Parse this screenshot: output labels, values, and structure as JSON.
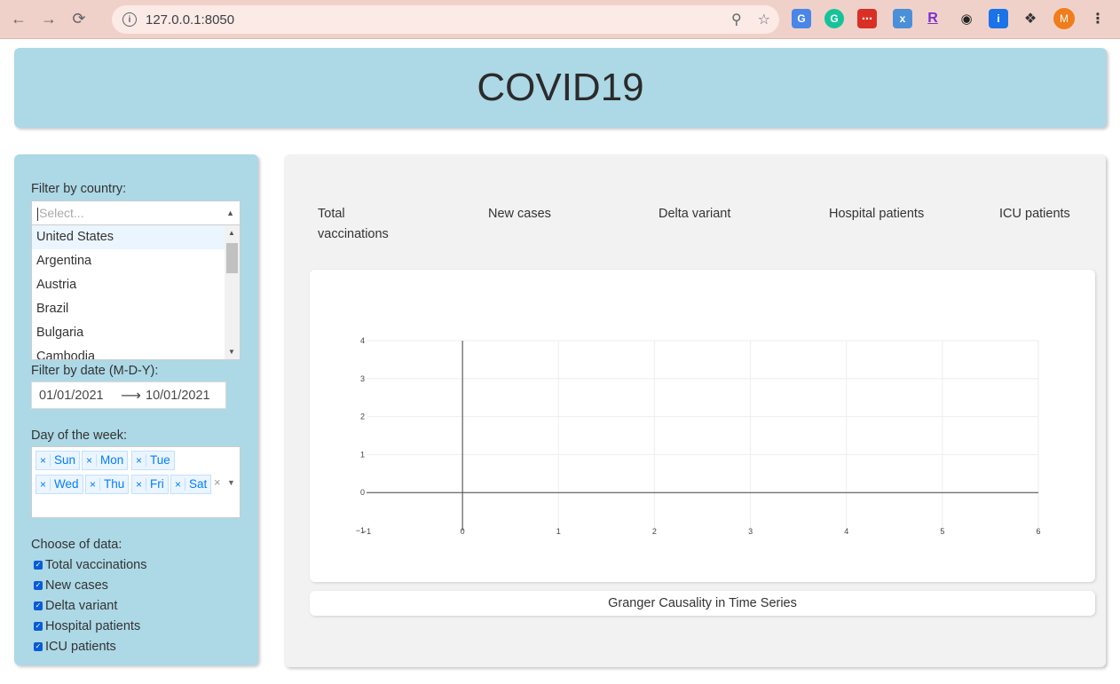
{
  "browser": {
    "url": "127.0.0.1:8050",
    "profile_initial": "M"
  },
  "header": {
    "title": "COVID19"
  },
  "sidebar": {
    "country_label": "Filter by country:",
    "country_placeholder": "Select...",
    "country_options": [
      "United States",
      "Argentina",
      "Austria",
      "Brazil",
      "Bulgaria",
      "Cambodia"
    ],
    "date_label": "Filter by date (M-D-Y):",
    "date_start": "01/01/2021",
    "date_end": "10/01/2021",
    "weekday_label": "Day of the week:",
    "weekdays": [
      "Sun",
      "Mon",
      "Tue",
      "Wed",
      "Thu",
      "Fri",
      "Sat"
    ],
    "data_label": "Choose of data:",
    "data_options": [
      {
        "label": "Total vaccinations",
        "checked": true
      },
      {
        "label": "New cases",
        "checked": true
      },
      {
        "label": "Delta variant",
        "checked": true
      },
      {
        "label": "Hospital patients",
        "checked": true
      },
      {
        "label": "ICU patients",
        "checked": true
      }
    ]
  },
  "main": {
    "tabs": [
      "Total\nvaccinations",
      "New cases",
      "Delta variant",
      "Hospital patients",
      "ICU patients"
    ],
    "footer": "Granger Causality in Time Series"
  },
  "chart_data": {
    "type": "line",
    "series": [],
    "xlim": [
      -1,
      6
    ],
    "ylim": [
      -1,
      4
    ],
    "x_ticks": [
      "−1",
      "0",
      "1",
      "2",
      "3",
      "4",
      "5",
      "6"
    ],
    "y_ticks": [
      "−1",
      "0",
      "1",
      "2",
      "3",
      "4"
    ],
    "grid": true,
    "title": "",
    "xlabel": "",
    "ylabel": ""
  }
}
